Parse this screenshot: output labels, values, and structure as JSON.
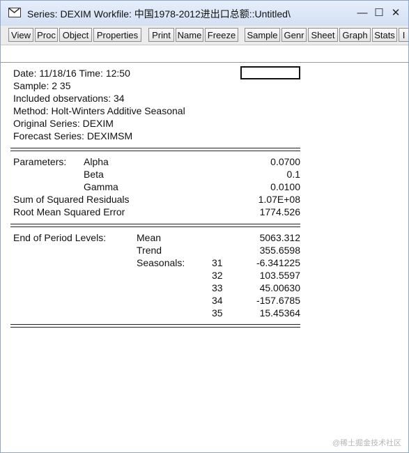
{
  "window": {
    "title": "Series: DEXIM   Workfile: 中国1978-2012进出口总额::Untitled\\",
    "min_glyph": "—",
    "max_glyph": "☐",
    "close_glyph": "✕"
  },
  "toolbar": {
    "buttons": [
      "View",
      "Proc",
      "Object",
      "Properties",
      "Print",
      "Name",
      "Freeze",
      "Sample",
      "Genr",
      "Sheet",
      "Graph",
      "Stats",
      "I"
    ]
  },
  "output": {
    "date_line": "Date: 11/18/16   Time: 12:50",
    "sample_line": "Sample: 2 35",
    "obs_line": "Included observations: 34",
    "method_line": "Method: Holt-Winters Additive Seasonal",
    "original_line": "Original Series: DEXIM",
    "forecast_line": "Forecast Series: DEXIMSM",
    "parameters_label": "Parameters:",
    "params": [
      {
        "name": "Alpha",
        "value": "0.0700"
      },
      {
        "name": "Beta",
        "value": "0.1"
      },
      {
        "name": "Gamma",
        "value": "0.0100"
      }
    ],
    "ssr_label": "Sum of Squared Residuals",
    "ssr_value": "1.07E+08",
    "rmse_label": "Root Mean Squared Error",
    "rmse_value": "1774.526",
    "end_label": "End of Period Levels:",
    "mean_label": "Mean",
    "mean_value": "5063.312",
    "trend_label": "Trend",
    "trend_value": "355.6598",
    "seasonals_label": "Seasonals:",
    "seasonals": [
      {
        "period": "31",
        "value": "-6.341225"
      },
      {
        "period": "32",
        "value": "103.5597"
      },
      {
        "period": "33",
        "value": "45.00630"
      },
      {
        "period": "34",
        "value": "-157.6785"
      },
      {
        "period": "35",
        "value": "15.45364"
      }
    ]
  },
  "watermark": "@稀土掘金技术社区"
}
